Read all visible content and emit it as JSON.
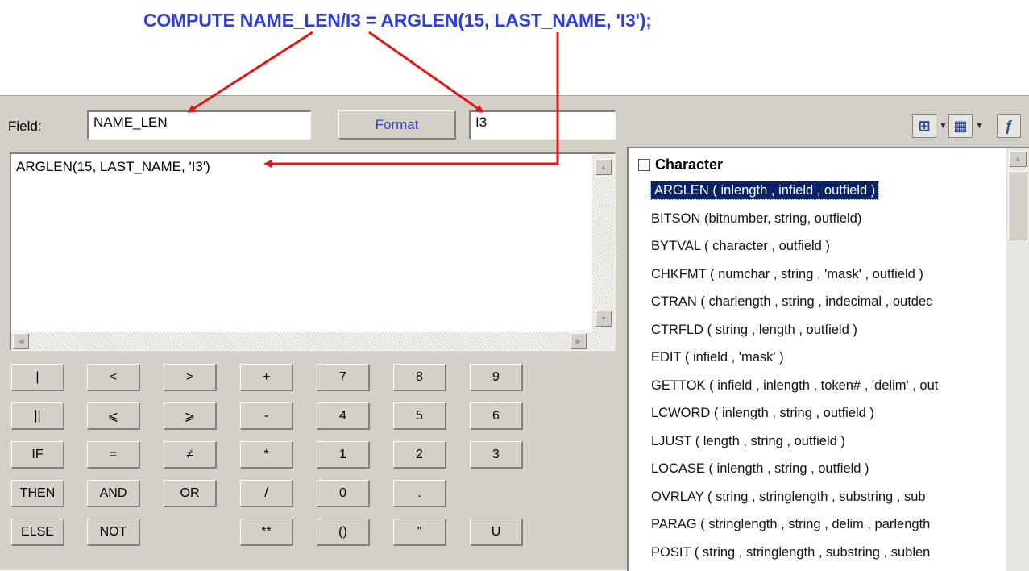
{
  "annotation": "COMPUTE NAME_LEN/I3 = ARGLEN(15, LAST_NAME, 'I3');",
  "field": {
    "label": "Field:",
    "value": "NAME_LEN"
  },
  "format": {
    "button_label": "Format",
    "value": "I3"
  },
  "toolbar_icons": [
    "tree-view-icon",
    "grid-view-icon",
    "function-icon"
  ],
  "editor": {
    "text": "ARGLEN(15, LAST_NAME, 'I3')"
  },
  "keypad": {
    "rows": [
      [
        "|",
        "<",
        ">",
        "+",
        "7",
        "8",
        "9"
      ],
      [
        "||",
        "⩽",
        "⩾",
        "-",
        "4",
        "5",
        "6"
      ],
      [
        "IF",
        "=",
        "≠",
        "*",
        "1",
        "2",
        "3"
      ],
      [
        "THEN",
        "AND",
        "OR",
        "/",
        "0",
        ".",
        ""
      ],
      [
        "ELSE",
        "NOT",
        "",
        "**",
        "()",
        "\"",
        "U"
      ]
    ]
  },
  "function_list": {
    "category": "Character",
    "items": [
      "ARGLEN ( inlength , infield , outfield )",
      "BITSON (bitnumber, string, outfield)",
      "BYTVAL ( character , outfield )",
      "CHKFMT ( numchar , string , 'mask' , outfield )",
      "CTRAN ( charlength , string , indecimal , outdec",
      "CTRFLD ( string , length , outfield )",
      "EDIT ( infield , 'mask' )",
      "GETTOK ( infield , inlength , token# , 'delim' , out",
      "LCWORD ( inlength , string , outfield )",
      "LJUST ( length , string , outfield )",
      "LOCASE ( inlength , string , outfield )",
      "OVRLAY ( string , stringlength , substring , sub",
      "PARAG ( stringlength , string , delim , parlength",
      "POSIT ( string , stringlength , substring , sublen"
    ],
    "selected_index": 0
  },
  "colors": {
    "annotation": "#2f3fd6",
    "arrows": "#e01818",
    "selection": "#0a246a",
    "panel": "#d4d0c8"
  }
}
